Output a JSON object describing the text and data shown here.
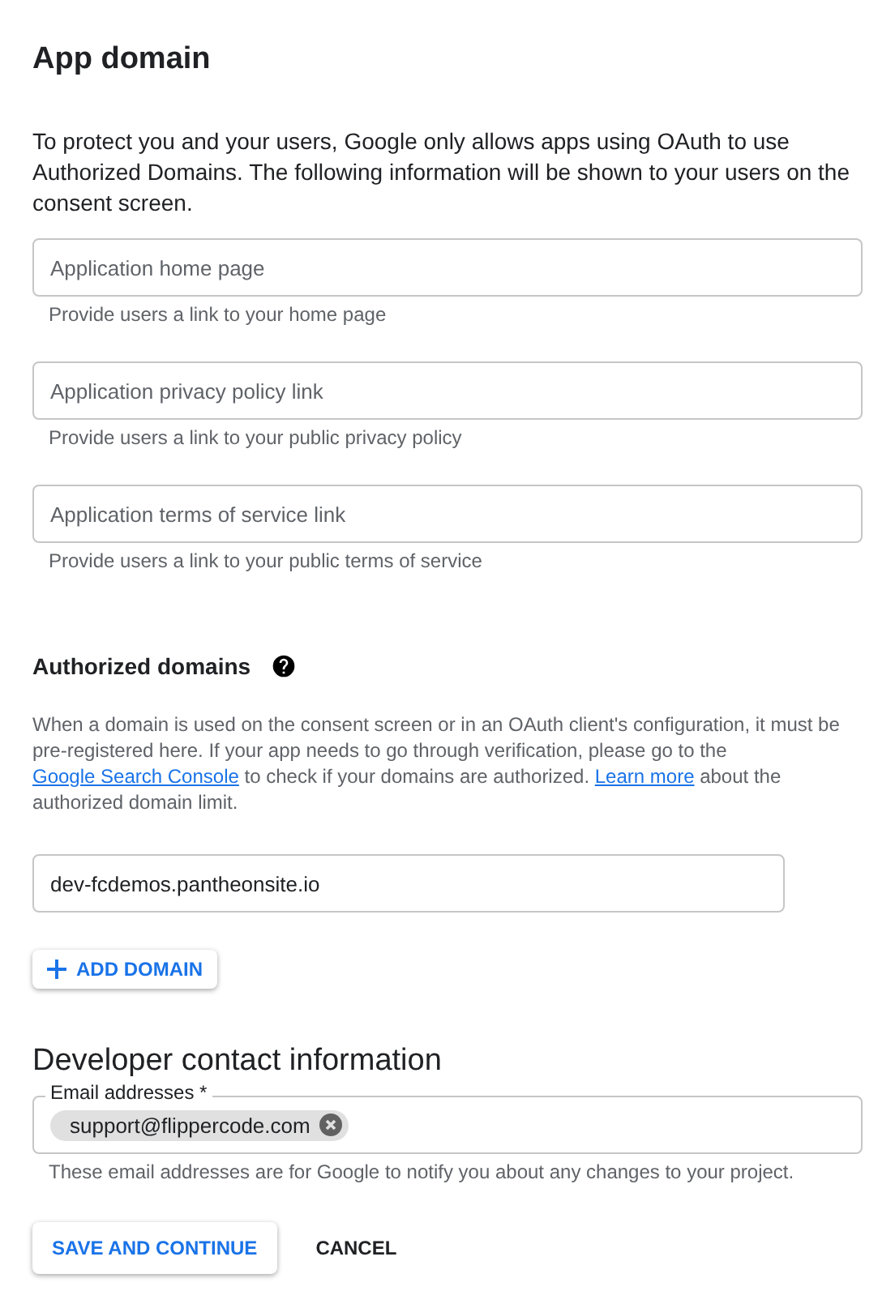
{
  "app_domain": {
    "title": "App domain",
    "intro": "To protect you and your users, Google only allows apps using OAuth to use Authorized Domains. The following information will be shown to your users on the consent screen.",
    "fields": [
      {
        "placeholder": "Application home page",
        "hint": "Provide users a link to your home page"
      },
      {
        "placeholder": "Application privacy policy link",
        "hint": "Provide users a link to your public privacy policy"
      },
      {
        "placeholder": "Application terms of service link",
        "hint": "Provide users a link to your public terms of service"
      }
    ]
  },
  "authorized_domains": {
    "title": "Authorized domains",
    "description": [
      {
        "kind": "text",
        "text": "When a domain is used on the consent screen or in an OAuth client's configuration, it must be pre-registered here. If your app needs to go through verification, please go to the "
      },
      {
        "kind": "link",
        "text": "Google Search Console"
      },
      {
        "kind": "text",
        "text": " to check if your domains are authorized. "
      },
      {
        "kind": "link",
        "text": "Learn more"
      },
      {
        "kind": "text",
        "text": " about the authorized domain limit."
      }
    ],
    "domains": [
      "dev-fcdemos.pantheonsite.io"
    ],
    "add_button": "ADD DOMAIN"
  },
  "developer_contact": {
    "title": "Developer contact information",
    "field_label": "Email addresses *",
    "chips": [
      "support@flippercode.com"
    ],
    "hint": "These email addresses are for Google to notify you about any changes to your project."
  },
  "buttons": [
    {
      "label": "SAVE AND CONTINUE",
      "kind": "raised"
    },
    {
      "label": "CANCEL",
      "kind": "flat"
    }
  ]
}
